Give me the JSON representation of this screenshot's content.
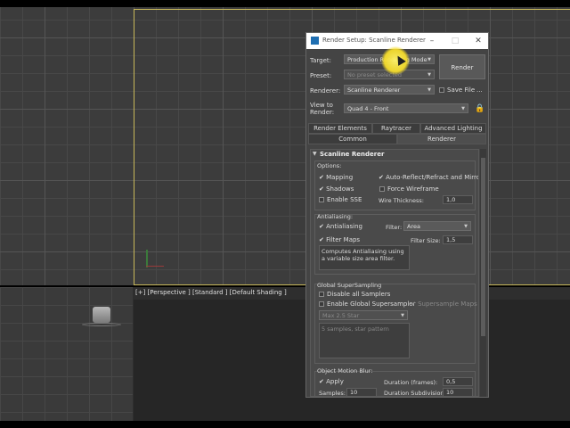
{
  "viewport": {
    "label": "[+] [Perspective ] [Standard ] [Default Shading ]"
  },
  "dialog": {
    "title": "Render Setup: Scanline Renderer",
    "target_label": "Target:",
    "target_value": "Production Rendering Mode",
    "preset_label": "Preset:",
    "preset_value": "No preset selected",
    "renderer_label": "Renderer:",
    "renderer_value": "Scanline Renderer",
    "save_file_label": "Save File",
    "more_label": "...",
    "view_to_render_label_1": "View to",
    "view_to_render_label_2": "Render:",
    "view_to_render_value": "Quad 4 - Front",
    "render_button": "Render",
    "tabs_row1": [
      "Render Elements",
      "Raytracer",
      "Advanced Lighting"
    ],
    "tabs_row2": [
      "Common",
      "Renderer"
    ],
    "selected_tab": "Renderer"
  },
  "rollout": {
    "title": "Scanline Renderer",
    "options": {
      "label": "Options:",
      "mapping": "Mapping",
      "shadows": "Shadows",
      "enable_sse": "Enable SSE",
      "auto_reflect": "Auto-Reflect/Refract and Mirrors",
      "force_wireframe": "Force Wireframe",
      "wire_thickness_label": "Wire Thickness:",
      "wire_thickness_value": "1,0"
    },
    "antialiasing": {
      "label": "Antialiasing:",
      "antialiasing": "Antialiasing",
      "filter_label": "Filter:",
      "filter_value": "Area",
      "filter_maps": "Filter Maps",
      "filter_size_label": "Filter Size:",
      "filter_size_value": "1,5",
      "description": "Computes Antialiasing using a variable size area filter."
    },
    "global_supersampling": {
      "label": "Global SuperSampling",
      "disable_all": "Disable all Samplers",
      "enable_global": "Enable Global Supersampler",
      "supersample_maps": "Supersample Maps",
      "sampler_value": "Max 2.5 Star",
      "description": "5 samples, star pattern"
    },
    "motion_blur": {
      "label": "Object Motion Blur:",
      "apply": "Apply",
      "duration_frames_label": "Duration (frames):",
      "duration_frames_value": "0,5",
      "samples_label": "Samples:",
      "samples_value": "10",
      "duration_subdiv_label": "Duration Subdivisions:",
      "duration_subdiv_value": "10"
    }
  },
  "colors": {
    "active_viewport_border": "#c8b85a",
    "dialog_bg": "#444444",
    "cursor_highlight": "#f5dc2a"
  }
}
